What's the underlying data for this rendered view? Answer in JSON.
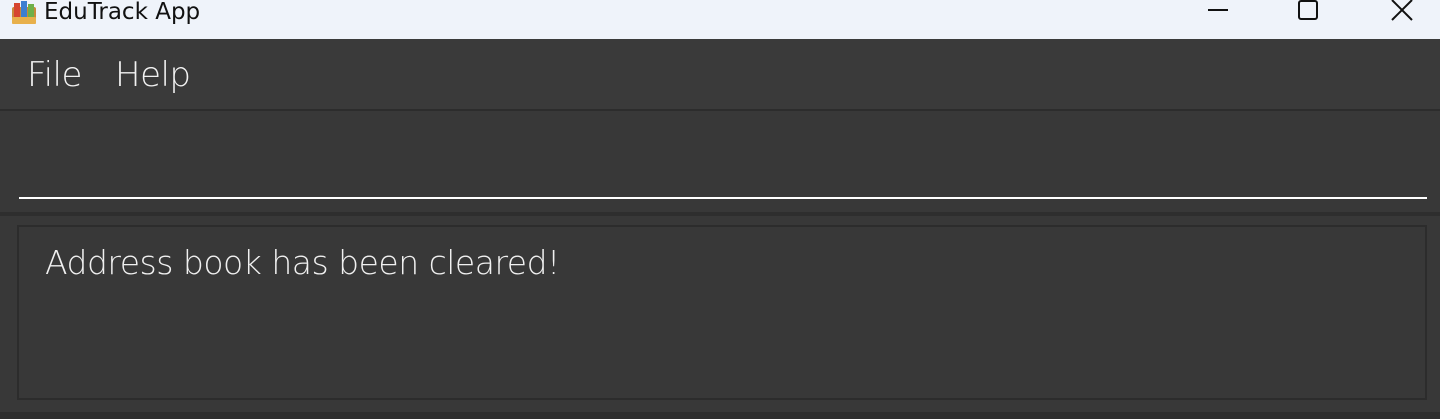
{
  "window": {
    "title": "EduTrack App",
    "icon": "books-app-icon"
  },
  "titlebar_controls": {
    "minimize_icon": "minimize-icon",
    "maximize_icon": "maximize-icon",
    "close_icon": "close-icon"
  },
  "menubar": {
    "items": [
      {
        "label": "File"
      },
      {
        "label": "Help"
      }
    ]
  },
  "command_box": {
    "value": "",
    "placeholder": ""
  },
  "result_display": {
    "message": "Address book has been cleared!"
  },
  "colors": {
    "background": "#383838",
    "titlebar": "#eff3fa",
    "text": "#f0f0f0",
    "input_underline": "#ffffff"
  }
}
